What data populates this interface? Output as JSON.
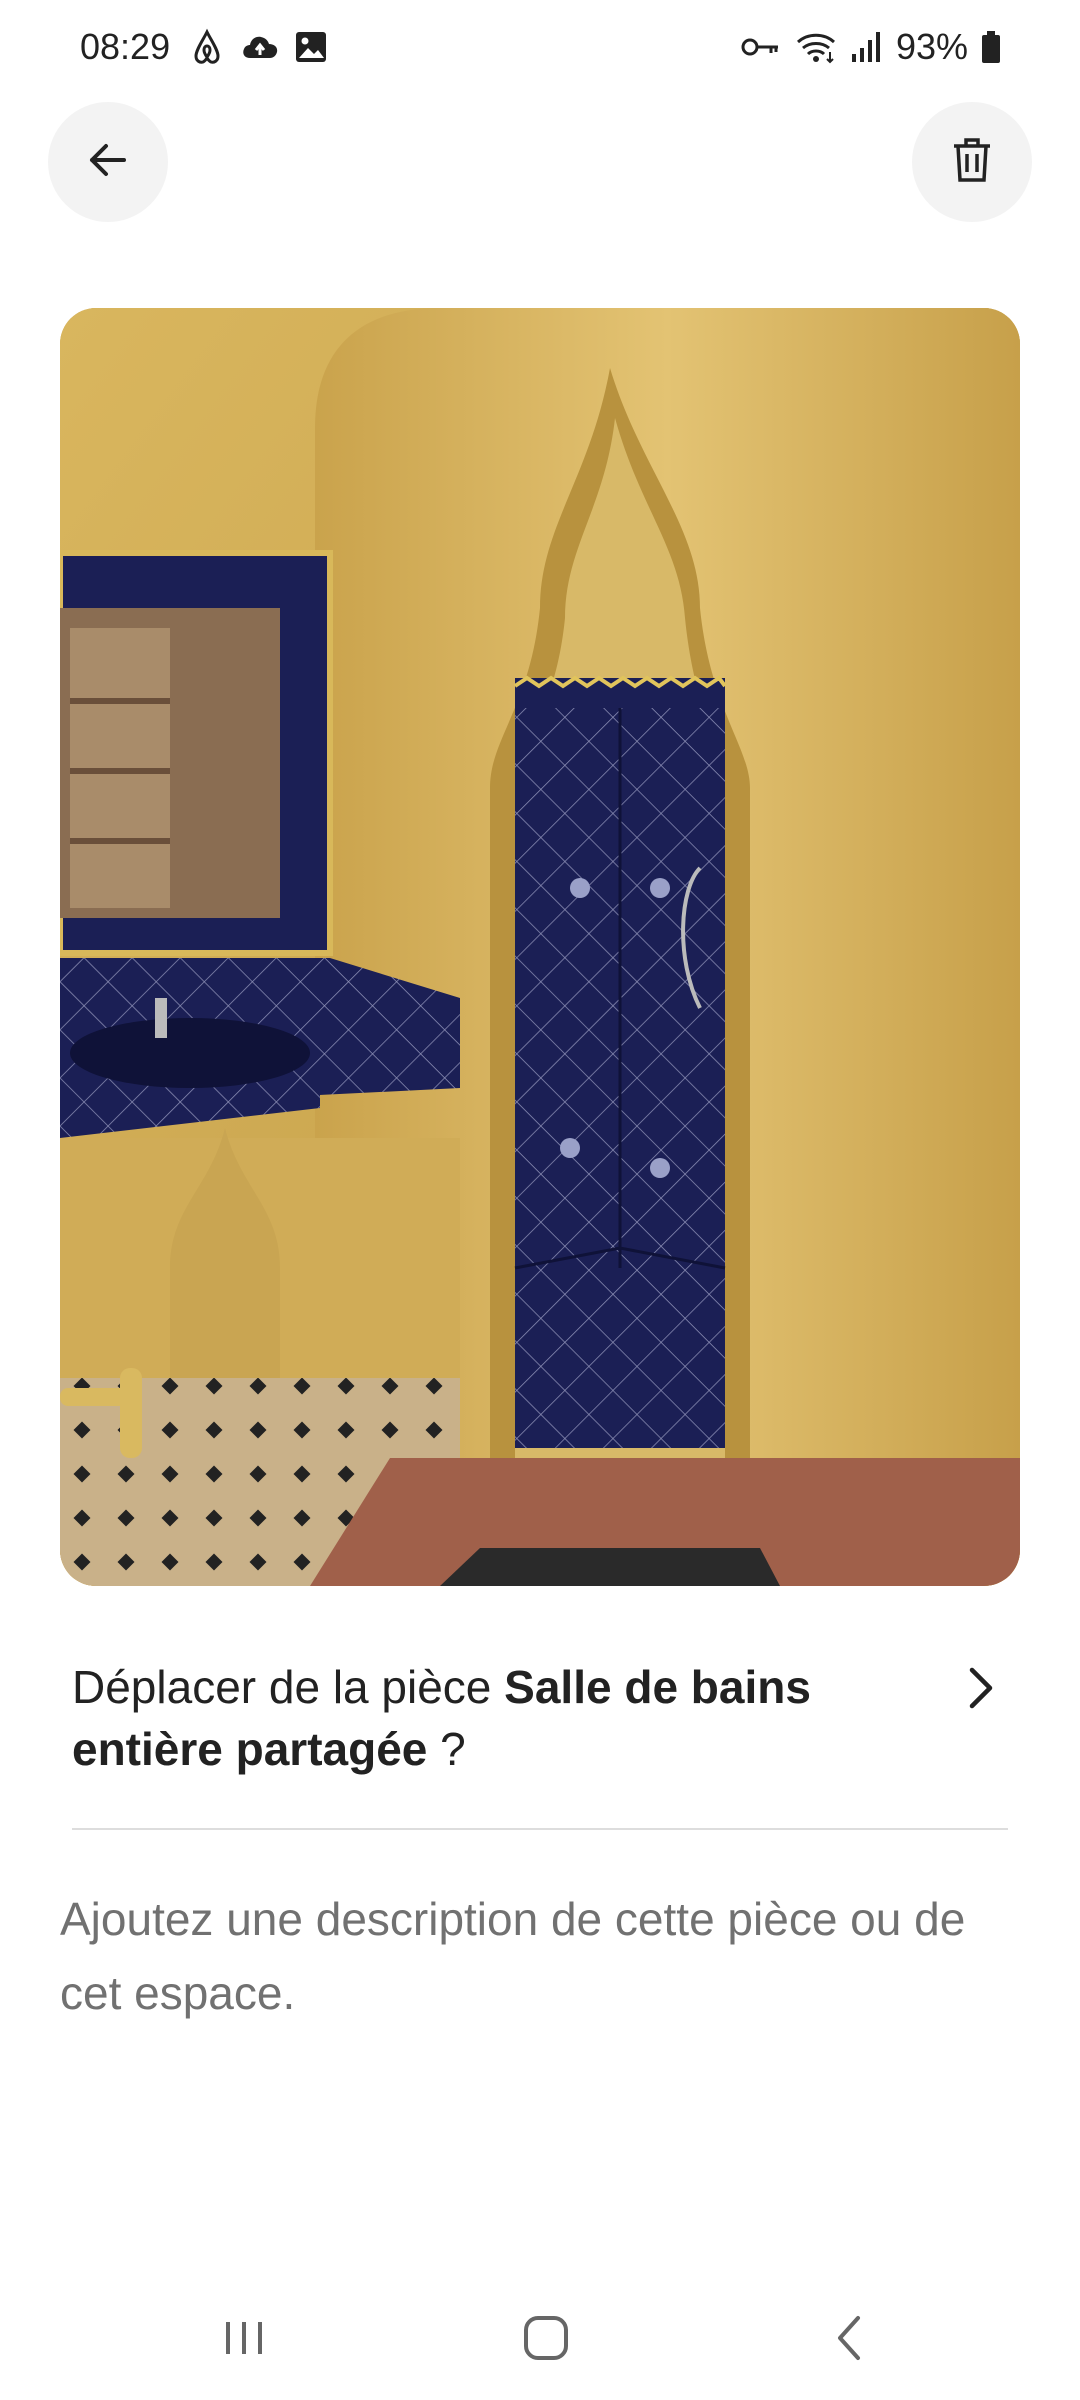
{
  "status_bar": {
    "time": "08:29",
    "battery": "93%",
    "left_icons": [
      "airbnb-icon",
      "cloud-upload-icon",
      "image-icon"
    ],
    "right_icons": [
      "key-icon",
      "wifi-icon",
      "signal-icon",
      "battery-icon"
    ]
  },
  "header": {
    "back_icon": "arrow-left-icon",
    "delete_icon": "trash-icon"
  },
  "photo": {
    "subject": "bathroom"
  },
  "move_room": {
    "prefix": "Déplacer de la pièce ",
    "room_name": "Salle de bains entière partagée",
    "suffix": " ?"
  },
  "description": {
    "placeholder": "Ajoutez une description de cette pièce ou de cet espace."
  },
  "nav": {
    "icons": [
      "recent-apps-icon",
      "home-icon",
      "back-icon"
    ]
  },
  "colors": {
    "text_primary": "#222222",
    "text_secondary": "#717171",
    "button_bg": "#f3f3f3",
    "divider": "#dddddd"
  }
}
